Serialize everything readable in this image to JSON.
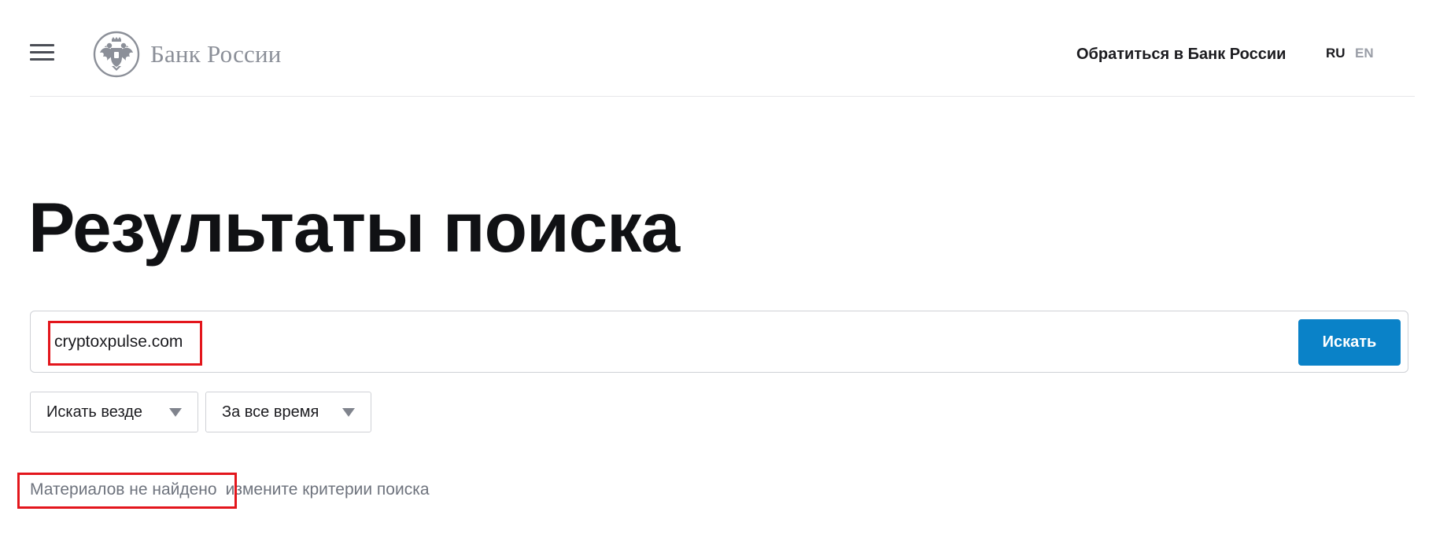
{
  "header": {
    "menu_icon": "hamburger-menu-icon",
    "logo_icon": "double-headed-eagle-emblem-icon",
    "logo_text": "Банк России",
    "contact_link": "Обратиться в Банк России",
    "languages": [
      "RU",
      "EN"
    ],
    "active_language": "RU"
  },
  "page": {
    "title": "Результаты поиска"
  },
  "search": {
    "query": "cryptoxpulse.com",
    "button_label": "Искать",
    "button_color": "#0a82c8"
  },
  "filters": {
    "scope": {
      "selected": "Искать везде",
      "icon": "triangle-down-icon"
    },
    "period": {
      "selected": "За все время",
      "icon": "triangle-down-icon"
    }
  },
  "results": {
    "message": "Материалов не найдено",
    "hint": "измените критерии поиска"
  },
  "annotations": {
    "highlight_color": "#e3161c"
  }
}
